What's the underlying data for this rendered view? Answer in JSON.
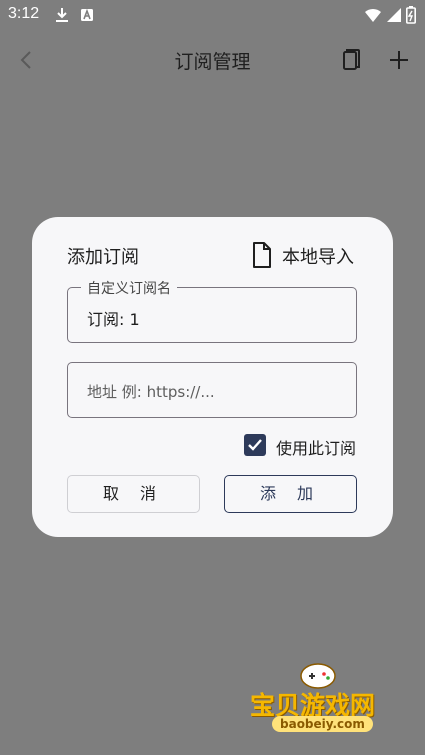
{
  "status_bar": {
    "time": "3:12",
    "icons": [
      "download-icon",
      "notification-a-icon",
      "wifi-icon",
      "signal-icon",
      "battery-icon"
    ]
  },
  "app_bar": {
    "title": "订阅管理",
    "icons": [
      "back-icon",
      "copy-icon",
      "add-icon"
    ]
  },
  "dialog": {
    "title": "添加订阅",
    "import_label": "本地导入",
    "name_field": {
      "label": "自定义订阅名",
      "value": "订阅: 1"
    },
    "url_field": {
      "placeholder": "地址 例: https://..."
    },
    "checkbox": {
      "label": "使用此订阅",
      "checked": true
    },
    "cancel_label": "取 消",
    "confirm_label": "添 加"
  },
  "watermark": {
    "text": "宝贝游戏网",
    "url": "baobeiy.com"
  },
  "colors": {
    "scrim": "#7e7e7e",
    "dialog_bg": "#f7f7f9",
    "accent": "#2d3a5a",
    "outline": "#79747e"
  }
}
